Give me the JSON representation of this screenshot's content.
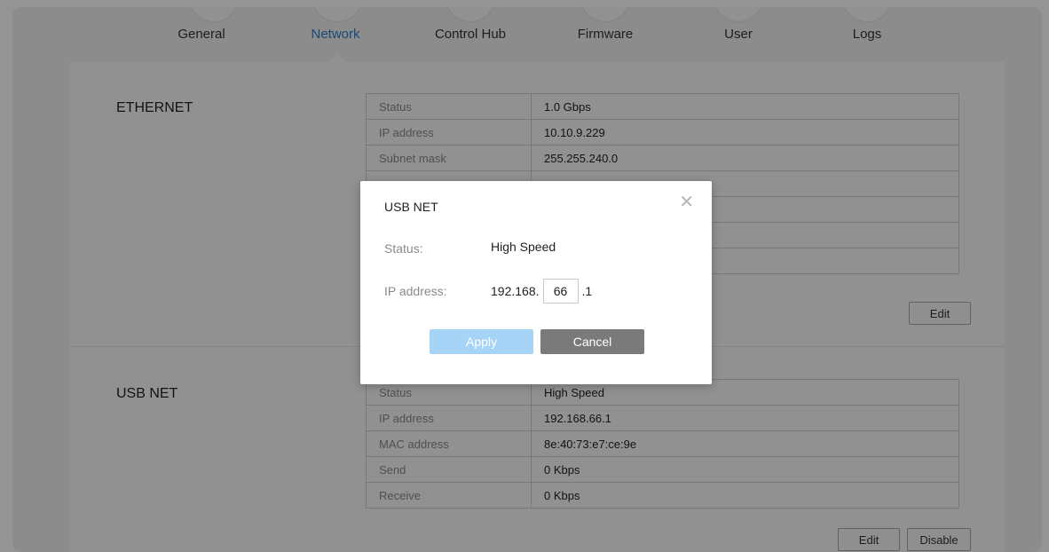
{
  "nav": {
    "tabs": [
      {
        "label": "General"
      },
      {
        "label": "Network"
      },
      {
        "label": "Control Hub"
      },
      {
        "label": "Firmware"
      },
      {
        "label": "User"
      },
      {
        "label": "Logs"
      }
    ],
    "active": "Network"
  },
  "ethernet": {
    "title": "ETHERNET",
    "rows": [
      {
        "key": "Status",
        "value": "1.0 Gbps"
      },
      {
        "key": "IP address",
        "value": "10.10.9.229"
      },
      {
        "key": "Subnet mask",
        "value": "255.255.240.0"
      },
      {
        "key": "",
        "value": ""
      },
      {
        "key": "",
        "value": ""
      },
      {
        "key": "",
        "value": ""
      },
      {
        "key": "",
        "value": ""
      }
    ],
    "edit_label": "Edit"
  },
  "usbnet": {
    "title": "USB NET",
    "rows": [
      {
        "key": "Status",
        "value": "High Speed"
      },
      {
        "key": "IP address",
        "value": "192.168.66.1"
      },
      {
        "key": "MAC address",
        "value": "8e:40:73:e7:ce:9e"
      },
      {
        "key": "Send",
        "value": "0 Kbps"
      },
      {
        "key": "Receive",
        "value": "0 Kbps"
      }
    ],
    "edit_label": "Edit",
    "disable_label": "Disable"
  },
  "modal": {
    "title": "USB NET",
    "close_icon": "close-icon",
    "status_label": "Status:",
    "status_value": "High Speed",
    "ip_label": "IP address:",
    "ip_prefix": "192.168.",
    "ip_octet": "66",
    "ip_suffix": ".1",
    "apply_label": "Apply",
    "cancel_label": "Cancel"
  },
  "colors": {
    "accent": "#2f7fd4",
    "apply_button": "#a6d4f7",
    "cancel_button": "#7a7a7a"
  }
}
